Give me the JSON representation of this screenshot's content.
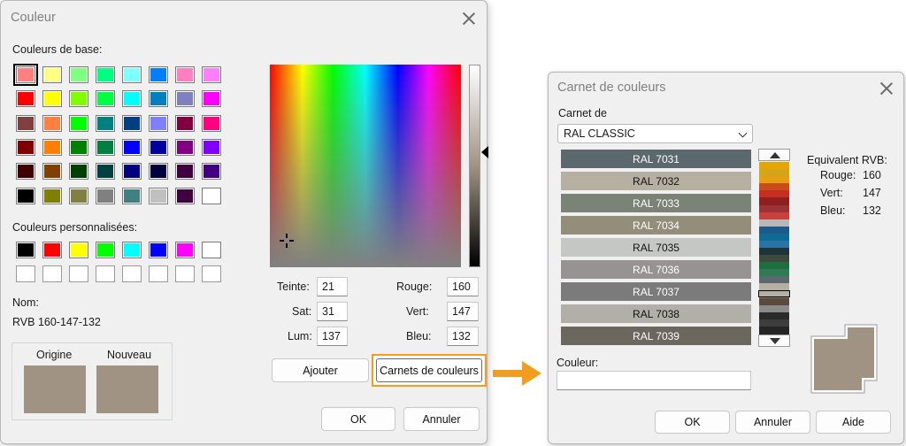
{
  "colors": {
    "accent_orange": "#f29d1d",
    "current_color": "#a09384",
    "dialog_bg": "#f0f0f0"
  },
  "couleur_dialog": {
    "title": "Couleur",
    "base_colors_label": "Couleurs de base:",
    "base_colors": [
      "#ff8080",
      "#ffff80",
      "#80ff80",
      "#00ff80",
      "#80ffff",
      "#0080ff",
      "#ff80c0",
      "#ff80ff",
      "#ff0000",
      "#ffff00",
      "#80ff00",
      "#00ff40",
      "#00ffff",
      "#0080c0",
      "#8080c0",
      "#ff00ff",
      "#804040",
      "#ff8040",
      "#00ff00",
      "#008080",
      "#004080",
      "#8080ff",
      "#800040",
      "#ff0080",
      "#800000",
      "#ff8000",
      "#008000",
      "#008040",
      "#0000ff",
      "#0000a0",
      "#800080",
      "#8000ff",
      "#400000",
      "#804000",
      "#004000",
      "#004040",
      "#000080",
      "#000040",
      "#400040",
      "#400080",
      "#000000",
      "#808000",
      "#808040",
      "#808080",
      "#408080",
      "#c0c0c0",
      "#400040",
      "#ffffff"
    ],
    "custom_colors_label": "Couleurs personnalisées:",
    "custom_colors": [
      "#000000",
      "#ff0000",
      "#ffff00",
      "#00ff00",
      "#00ffff",
      "#0000ff",
      "#ff00ff",
      "#ffffff",
      "#ffffff",
      "#ffffff",
      "#ffffff",
      "#ffffff",
      "#ffffff",
      "#ffffff",
      "#ffffff",
      "#ffffff"
    ],
    "name_label": "Nom:",
    "name_value": "RVB 160-147-132",
    "origin_label": "Origine",
    "new_label": "Nouveau",
    "hue_label": "Teinte:",
    "hue_value": "21",
    "sat_label": "Sat:",
    "sat_value": "31",
    "lum_label": "Lum:",
    "lum_value": "137",
    "red_label": "Rouge:",
    "red_value": "160",
    "green_label": "Vert:",
    "green_value": "147",
    "blue_label": "Bleu:",
    "blue_value": "132",
    "add_button": "Ajouter",
    "palettes_button": "Carnets de couleurs",
    "ok_button": "OK",
    "cancel_button": "Annuler"
  },
  "carnet_dialog": {
    "title": "Carnet de couleurs",
    "book_label": "Carnet de",
    "book_selected": "RAL CLASSIC",
    "ral_rows": [
      {
        "label": "RAL 7031",
        "color": "#5b686d",
        "text": "#ffffff"
      },
      {
        "label": "RAL 7032",
        "color": "#b5b0a1",
        "text": "#111111"
      },
      {
        "label": "RAL 7033",
        "color": "#7a8376",
        "text": "#ffffff"
      },
      {
        "label": "RAL 7034",
        "color": "#928e7a",
        "text": "#ffffff"
      },
      {
        "label": "RAL 7035",
        "color": "#c5c7c4",
        "text": "#111111"
      },
      {
        "label": "RAL 7036",
        "color": "#979392",
        "text": "#ffffff"
      },
      {
        "label": "RAL 7037",
        "color": "#7a7b7a",
        "text": "#ffffff"
      },
      {
        "label": "RAL 7038",
        "color": "#b0b0a9",
        "text": "#111111"
      },
      {
        "label": "RAL 7039",
        "color": "#6b665e",
        "text": "#ffffff"
      }
    ],
    "strip_colors": [
      "#e5a600",
      "#d4a41a",
      "#e4a010",
      "#c94d18",
      "#c72d21",
      "#8f1f1f",
      "#9c3236",
      "#c9403c",
      "#b8b8b8",
      "#1d5a8a",
      "#0e6b94",
      "#2874a8",
      "#1f3438",
      "#3d4b3f",
      "#1f6e3d",
      "#307a56",
      "#5b686d",
      "#b5b0a1",
      "#7a8376",
      "#5b4a3c",
      "#8a8a8a",
      "#2a2a2a",
      "#3d3d3d",
      "#252525"
    ],
    "rgb_equiv_label": "Equivalent RVB:",
    "red_label": "Rouge:",
    "red_value": "160",
    "green_label": "Vert:",
    "green_value": "147",
    "blue_label": "Bleu:",
    "blue_value": "132",
    "color_label": "Couleur:",
    "color_value": "",
    "ok_button": "OK",
    "cancel_button": "Annuler",
    "help_button": "Aide"
  }
}
